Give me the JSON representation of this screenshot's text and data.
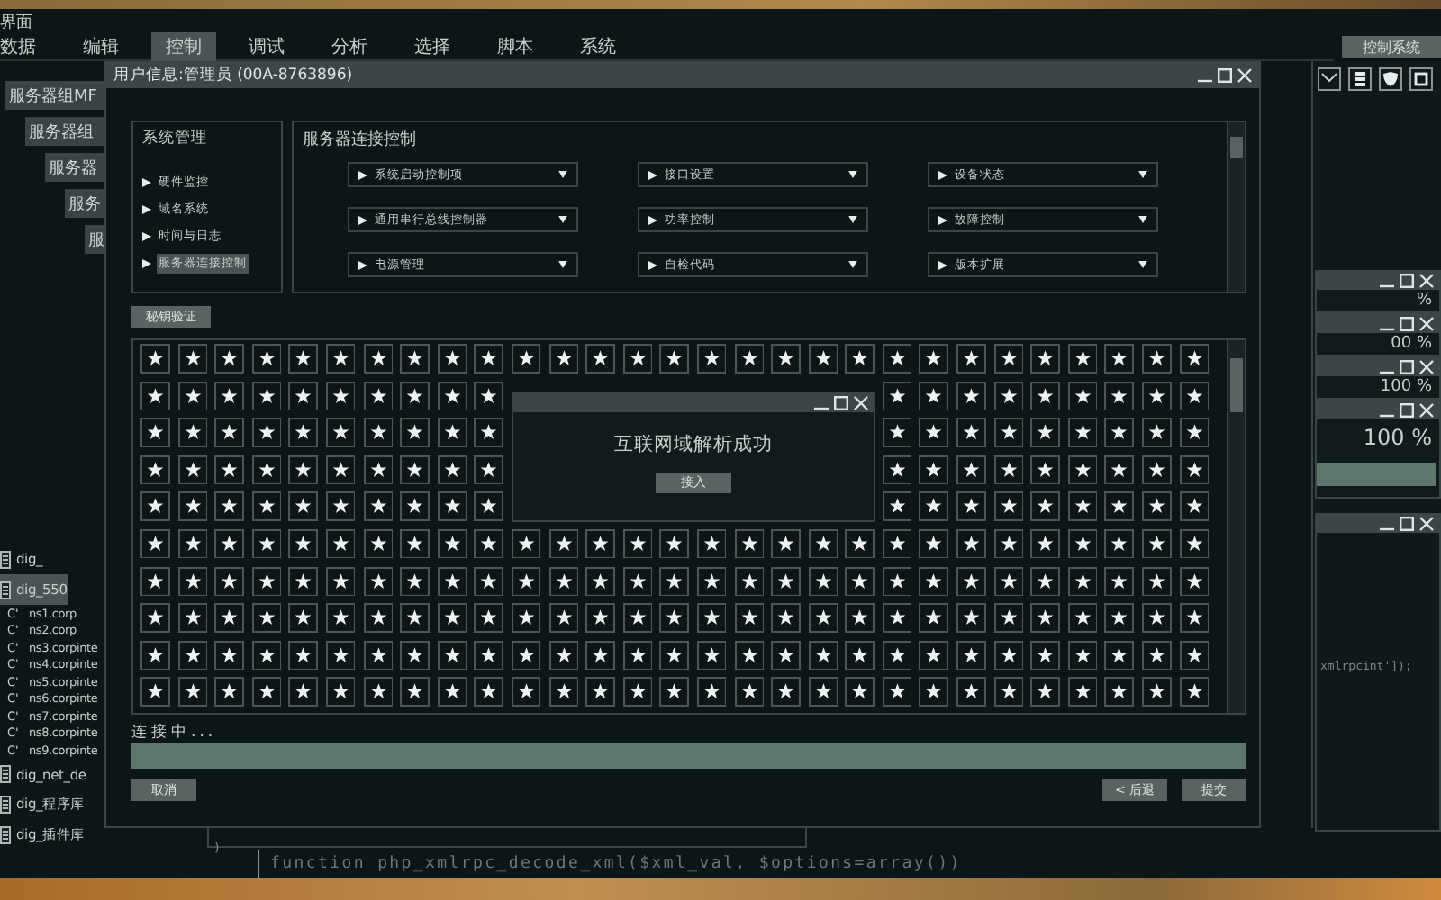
{
  "app": {
    "title": "界面",
    "corner_button": "控制系统"
  },
  "menu": [
    {
      "label": "数据",
      "selected": false
    },
    {
      "label": "编辑",
      "selected": false
    },
    {
      "label": "控制",
      "selected": true
    },
    {
      "label": "调试",
      "selected": false
    },
    {
      "label": "分析",
      "selected": false
    },
    {
      "label": "选择",
      "selected": false
    },
    {
      "label": "脚本",
      "selected": false
    },
    {
      "label": "系统",
      "selected": false
    }
  ],
  "background_windows": [
    {
      "title": "服务器组MF"
    },
    {
      "title": "服务器组"
    },
    {
      "title": "服务器"
    },
    {
      "title": "服务"
    },
    {
      "title": "服"
    }
  ],
  "file_list": [
    {
      "kind": "file",
      "label": "dig_",
      "selected": false
    },
    {
      "kind": "file",
      "label": "dig_550",
      "selected": true
    },
    {
      "kind": "record",
      "prefix": "C'",
      "label": "ns1.corp",
      "selected": false
    },
    {
      "kind": "record",
      "prefix": "C'",
      "label": "ns2.corp",
      "selected": false
    },
    {
      "kind": "record",
      "prefix": "C'",
      "label": "ns3.corpinte",
      "selected": false
    },
    {
      "kind": "record",
      "prefix": "C'",
      "label": "ns4.corpinte",
      "selected": false
    },
    {
      "kind": "record",
      "prefix": "C'",
      "label": "ns5.corpinte",
      "selected": false
    },
    {
      "kind": "record",
      "prefix": "C'",
      "label": "ns6.corpinte",
      "selected": false
    },
    {
      "kind": "record",
      "prefix": "C'",
      "label": "ns7.corpinte",
      "selected": false
    },
    {
      "kind": "record",
      "prefix": "C'",
      "label": "ns8.corpinte",
      "selected": false
    },
    {
      "kind": "record",
      "prefix": "C'",
      "label": "ns9.corpinte",
      "selected": false
    },
    {
      "kind": "file",
      "label": "dig_net_de",
      "selected": false
    },
    {
      "kind": "file",
      "label": "dig_程序库",
      "selected": false
    },
    {
      "kind": "file",
      "label": "dig_插件库",
      "selected": false
    }
  ],
  "progress_windows": [
    {
      "kind": "strip",
      "reading": "%"
    },
    {
      "kind": "strip",
      "reading": "00 %"
    },
    {
      "kind": "strip",
      "reading": "100 %"
    },
    {
      "kind": "full",
      "reading": "100 %",
      "level": 1
    }
  ],
  "log_window": {
    "text": "xmlrpcint']);"
  },
  "dialog": {
    "title": "用户信息:管理员 (00A-8763896)",
    "nav": {
      "heading": "系统管理",
      "items": [
        {
          "label": "硬件监控",
          "selected": false
        },
        {
          "label": "域名系统",
          "selected": false
        },
        {
          "label": "时间与日志",
          "selected": false
        },
        {
          "label": "服务器连接控制",
          "selected": true
        }
      ]
    },
    "panel": {
      "heading": "服务器连接控制",
      "dropdowns": [
        "系统启动控制项",
        "接口设置",
        "设备状态",
        "通用串行总线控制器",
        "功率控制",
        "故障控制",
        "电源管理",
        "自检代码",
        "版本扩展"
      ]
    },
    "verify_button": "秘钥验证",
    "popup": {
      "message": "互联网域解析成功",
      "button": "接入"
    },
    "status": "连接中...",
    "progress": {
      "level": 1
    },
    "buttons": {
      "cancel": "取消",
      "back": "< 后退",
      "submit": "提交"
    }
  },
  "code": {
    "box_text": ")",
    "line": "function php_xmlrpc_decode_xml($xml_val, $options=array())"
  }
}
